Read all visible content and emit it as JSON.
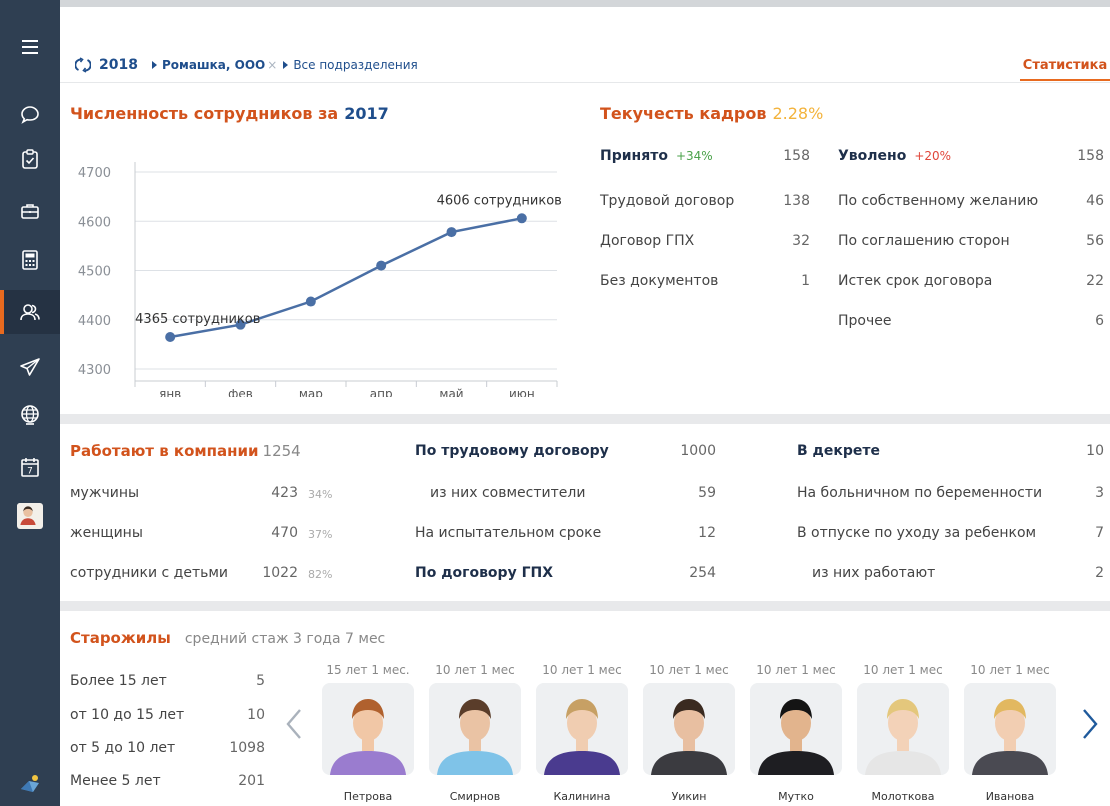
{
  "sidebar": {
    "icons": [
      "menu-icon",
      "chat-icon",
      "clipboard-icon",
      "briefcase-icon",
      "calculator-icon",
      "people-icon",
      "paper-plane-icon",
      "globe-icon",
      "calendar-icon",
      "user-avatar"
    ],
    "calendar_day": "7",
    "active_index": 5
  },
  "header": {
    "year": "2018",
    "org": "Ромашка, ООО",
    "org_clear": "×",
    "department": "Все подразделения",
    "tab_statistics": "Статистика"
  },
  "headcount": {
    "title": "Численность сотрудников за",
    "year": "2017"
  },
  "chart_data": {
    "type": "line",
    "categories": [
      "янв",
      "фев",
      "мар",
      "апр",
      "май",
      "июн"
    ],
    "values": [
      4365,
      4390,
      4437,
      4510,
      4578,
      4606
    ],
    "ylim": [
      4300,
      4700
    ],
    "yticks": [
      "4300",
      "4400",
      "4500",
      "4600",
      "4700"
    ],
    "annotations": [
      {
        "index": 0,
        "text": "4365 сотрудников"
      },
      {
        "index": 5,
        "text": "4606 сотрудников"
      }
    ],
    "color": "#4a6fa5",
    "grid": true
  },
  "turnover": {
    "title": "Текучесть кадров",
    "percent": "2.28%",
    "hired": {
      "label": "Принято",
      "delta": "+34%",
      "total": "158",
      "rows": [
        {
          "label": "Трудовой договор",
          "value": "138"
        },
        {
          "label": "Договор ГПХ",
          "value": "32"
        },
        {
          "label": "Без документов",
          "value": "1"
        }
      ]
    },
    "fired": {
      "label": "Уволено",
      "delta": "+20%",
      "total": "158",
      "rows": [
        {
          "label": "По собственному желанию",
          "value": "46"
        },
        {
          "label": "По соглашению сторон",
          "value": "56"
        },
        {
          "label": "Истек срок договора",
          "value": "22"
        },
        {
          "label": "Прочее",
          "value": "6"
        }
      ]
    }
  },
  "working": {
    "title": "Работают в компании",
    "total": "1254",
    "rows": [
      {
        "label": "мужчины",
        "value": "423",
        "pct": "34%"
      },
      {
        "label": "женщины",
        "value": "470",
        "pct": "37%"
      },
      {
        "label": "сотрудники с детьми",
        "value": "1022",
        "pct": "82%"
      }
    ]
  },
  "contracts": {
    "labor": {
      "label": "По трудовому договору",
      "value": "1000"
    },
    "part_time": {
      "label": "из них совместители",
      "value": "59"
    },
    "probation": {
      "label": "На испытательном сроке",
      "value": "12"
    },
    "gph": {
      "label": "По договору ГПХ",
      "value": "254"
    }
  },
  "leave": {
    "maternity": {
      "label": "В декрете",
      "value": "10"
    },
    "sick_pregnancy": {
      "label": "На больничном по беременности",
      "value": "3"
    },
    "childcare": {
      "label": "В отпуске по уходу за ребенком",
      "value": "7"
    },
    "childcare_working": {
      "label": "из них работают",
      "value": "2"
    }
  },
  "veterans": {
    "title": "Старожилы",
    "subtitle": "средний стаж 3 года 7 мес",
    "rows": [
      {
        "label": "Более 15 лет",
        "value": "5"
      },
      {
        "label": "от 10 до 15 лет",
        "value": "10"
      },
      {
        "label": "от 5 до 10 лет",
        "value": "1098"
      },
      {
        "label": "Менее 5 лет",
        "value": "201"
      }
    ],
    "people": [
      {
        "exp": "15 лет 1 мес.",
        "name": "Петрова",
        "shirt": "#9a7ccf",
        "hair": "#b0612e",
        "skin": "#f1c7a6"
      },
      {
        "exp": "10 лет 1 мес",
        "name": "Смирнов",
        "shirt": "#7fc3e8",
        "hair": "#5a3d2a",
        "skin": "#eac3a4"
      },
      {
        "exp": "10 лет 1 мес",
        "name": "Калинина",
        "shirt": "#4a3b8f",
        "hair": "#c7a064",
        "skin": "#f0cdb1"
      },
      {
        "exp": "10 лет 1 мес",
        "name": "Уикин",
        "shirt": "#3b3b40",
        "hair": "#3a2a20",
        "skin": "#e8bfa1"
      },
      {
        "exp": "10 лет 1 мес",
        "name": "Мутко",
        "shirt": "#1e1e22",
        "hair": "#141414",
        "skin": "#e2b48d"
      },
      {
        "exp": "10 лет 1 мес",
        "name": "Молоткова",
        "shirt": "#e6e6e6",
        "hair": "#e4c77c",
        "skin": "#f3d2b8"
      },
      {
        "exp": "10 лет 1 мес",
        "name": "Иванова",
        "shirt": "#4a4a52",
        "hair": "#e2b860",
        "skin": "#f2ceb2"
      }
    ]
  }
}
